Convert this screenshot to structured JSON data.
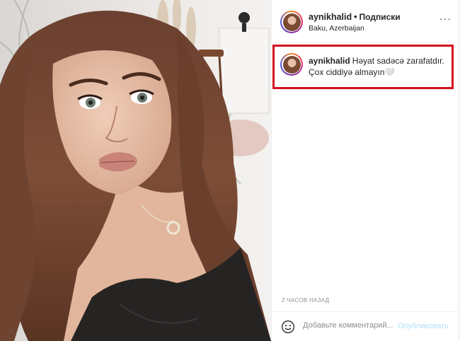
{
  "post": {
    "username": "aynikhalid",
    "follow_label": "Подписки",
    "location": "Baku, Azerbaijan",
    "more_icon": "more-options-icon"
  },
  "caption": {
    "username": "aynikhalid",
    "text": "Həyat sadəcə zarafatdır. Çox ciddiyə almayın🤍"
  },
  "timestamp": "2 ЧАСОВ НАЗАД",
  "comment_box": {
    "placeholder": "Добавьте комментарий...",
    "publish_label": "Опубликовать",
    "emoji_icon": "emoji-icon"
  },
  "colors": {
    "highlight_border": "#d40f1f",
    "publish_disabled": "#b2dffc",
    "secondary_text": "#8e8e8e"
  }
}
